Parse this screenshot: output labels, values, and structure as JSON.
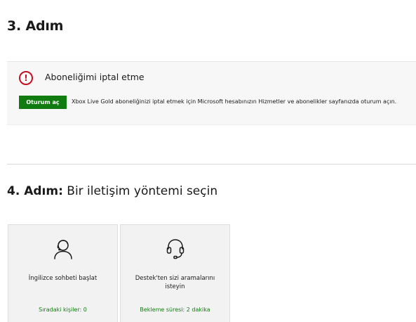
{
  "step3": {
    "title": "3. Adım"
  },
  "notice": {
    "icon": "alert-icon",
    "icon_glyph": "!",
    "heading": "Aboneliğimi iptal etme",
    "button_label": "Oturum aç",
    "text": "Xbox Live Gold aboneliğinizi iptal etmek için Microsoft hesabınızın Hizmetler ve abonelikler sayfanızda oturum açın.",
    "accent_color": "#107c10",
    "alert_color": "#c50f1f"
  },
  "step4": {
    "title_bold": "4. Adım:",
    "title_rest": " Bir iletişim yöntemi seçin"
  },
  "cards": [
    {
      "icon": "person-chat-icon",
      "label": "İngilizce sohbeti başlat",
      "status": "Sıradaki kişiler: 0"
    },
    {
      "icon": "headset-icon",
      "label": "Destek'ten sizi aramalarını isteyin",
      "status": "Bekleme süresi: 2 dakika"
    }
  ]
}
